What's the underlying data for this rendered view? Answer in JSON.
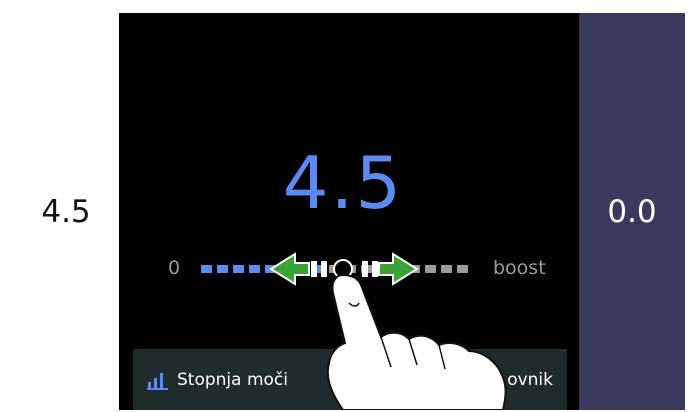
{
  "zones": {
    "left_value": "4.5",
    "right_value": "0.0"
  },
  "power_control": {
    "current_value": "4.5",
    "min_label": "0",
    "max_label": "boost",
    "active_segments_fraction": 0.42
  },
  "buttons": {
    "power_level_label": "Stopnja moči",
    "power_level_icon": "bar-chart-icon",
    "right_button_visible_text": "ovnik"
  },
  "colors": {
    "accent": "#5b8af5",
    "arrow_green": "#3aa335",
    "right_zone": "#3a3a5c",
    "button_bg": "#1f2b2d"
  }
}
